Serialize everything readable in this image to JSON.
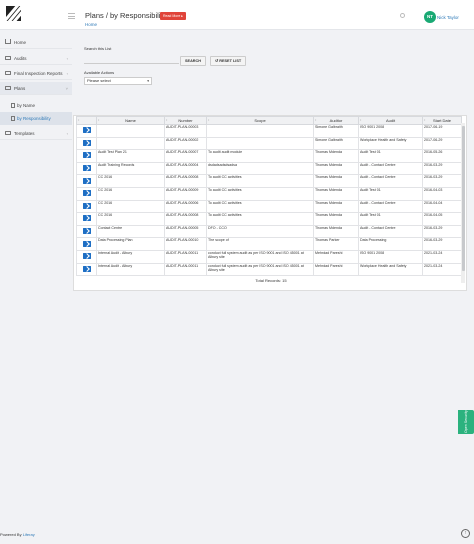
{
  "header": {
    "title": "Plans / by Responsibility",
    "read_more": "Read More ▸",
    "breadcrumb_home": "Home",
    "user_initials": "NT",
    "user_name": "Nick Taylor"
  },
  "sidebar": {
    "items": [
      {
        "label": "Home"
      },
      {
        "label": "Audits",
        "chevron": "‹"
      },
      {
        "label": "Final Inspection Reports",
        "chevron": "‹"
      },
      {
        "label": "Plans",
        "chevron": "˅"
      },
      {
        "label": "by Name"
      },
      {
        "label": "by Responsibility"
      },
      {
        "label": "Templates",
        "chevron": "‹"
      }
    ]
  },
  "filters": {
    "search_label": "Search this List",
    "search_button": "SEARCH",
    "reset_button": "↺ RESET LIST",
    "actions_label": "Available Actions",
    "actions_selected": "Please select"
  },
  "table": {
    "sort_icon": "↕",
    "columns": [
      "",
      "Name",
      "Number",
      "Scope",
      "Auditor",
      "Audit",
      "Start Date"
    ],
    "rows": [
      [
        "",
        "AUDIT-PLAN-00003",
        "",
        "Simone Galbraith",
        "ISO 9001 2008",
        "2017-06-19"
      ],
      [
        "",
        "AUDIT-PLAN-00002",
        "",
        "Simone Galbraith",
        "Workplace Health and Safety",
        "2017-06-29"
      ],
      [
        "Audit Test Plan 21",
        "AUDIT-PLAN-00007",
        "To audit audit module",
        "Thomas Mdenda",
        "Audit Test 01",
        "2016-05-26"
      ],
      [
        "Audit Training Records",
        "AUDIT-PLAN-00004",
        "dsdadsadsdsadsa",
        "Thomas Mdenda",
        "Audit - Contact Centre",
        "2016-03-29"
      ],
      [
        "CC 2016",
        "AUDIT-PLAN-00008",
        "To audit CC activities",
        "Thomas Mdenda",
        "Audit - Contact Centre",
        "2016-03-29"
      ],
      [
        "CC 2016",
        "AUDIT-PLAN-00009",
        "To audit CC activities",
        "Thomas Mdenda",
        "Audit Test 01",
        "2016-04-03"
      ],
      [
        "CC 2016",
        "AUDIT-PLAN-00006",
        "To audit CC activities",
        "Thomas Mdenda",
        "Audit - Contact Centre",
        "2016-04-04"
      ],
      [
        "CC 2016",
        "AUDIT-PLAN-00008",
        "To audit CC activities",
        "Thomas Mdenda",
        "Audit Test 01",
        "2016-04-05"
      ],
      [
        "Contact Centre",
        "AUDIT-PLAN-00005",
        "DFO - CCO",
        "Thomas Mdenda",
        "Audit - Contact Centre",
        "2016-03-29"
      ],
      [
        "Data Processing Plan",
        "AUDIT-PLAN-00010",
        "The scope of",
        "Thomas Parker",
        "Data Processing",
        "2016-03-29"
      ],
      [
        "Internal Audit - Albury",
        "AUDIT-PLAN-00011",
        "conduct full system audit as per ISO 9001 and ISO 45001 at Albury site",
        "Mehrdad Pareshi",
        "ISO 9001 2008",
        "2021-03-24"
      ],
      [
        "Internal Audit - Albury",
        "AUDIT-PLAN-00011",
        "conduct full system audit as per ISO 9001 and ISO 45001 at Albury site",
        "Mehrdad Pareshi",
        "Workplace Health and Safety",
        "2021-03-24"
      ]
    ],
    "total": "Total Records: 15"
  },
  "open_security": "Open Security",
  "footer": {
    "prefix": "Powered By",
    "brand": "Liferay"
  },
  "scroll_top": "↑"
}
